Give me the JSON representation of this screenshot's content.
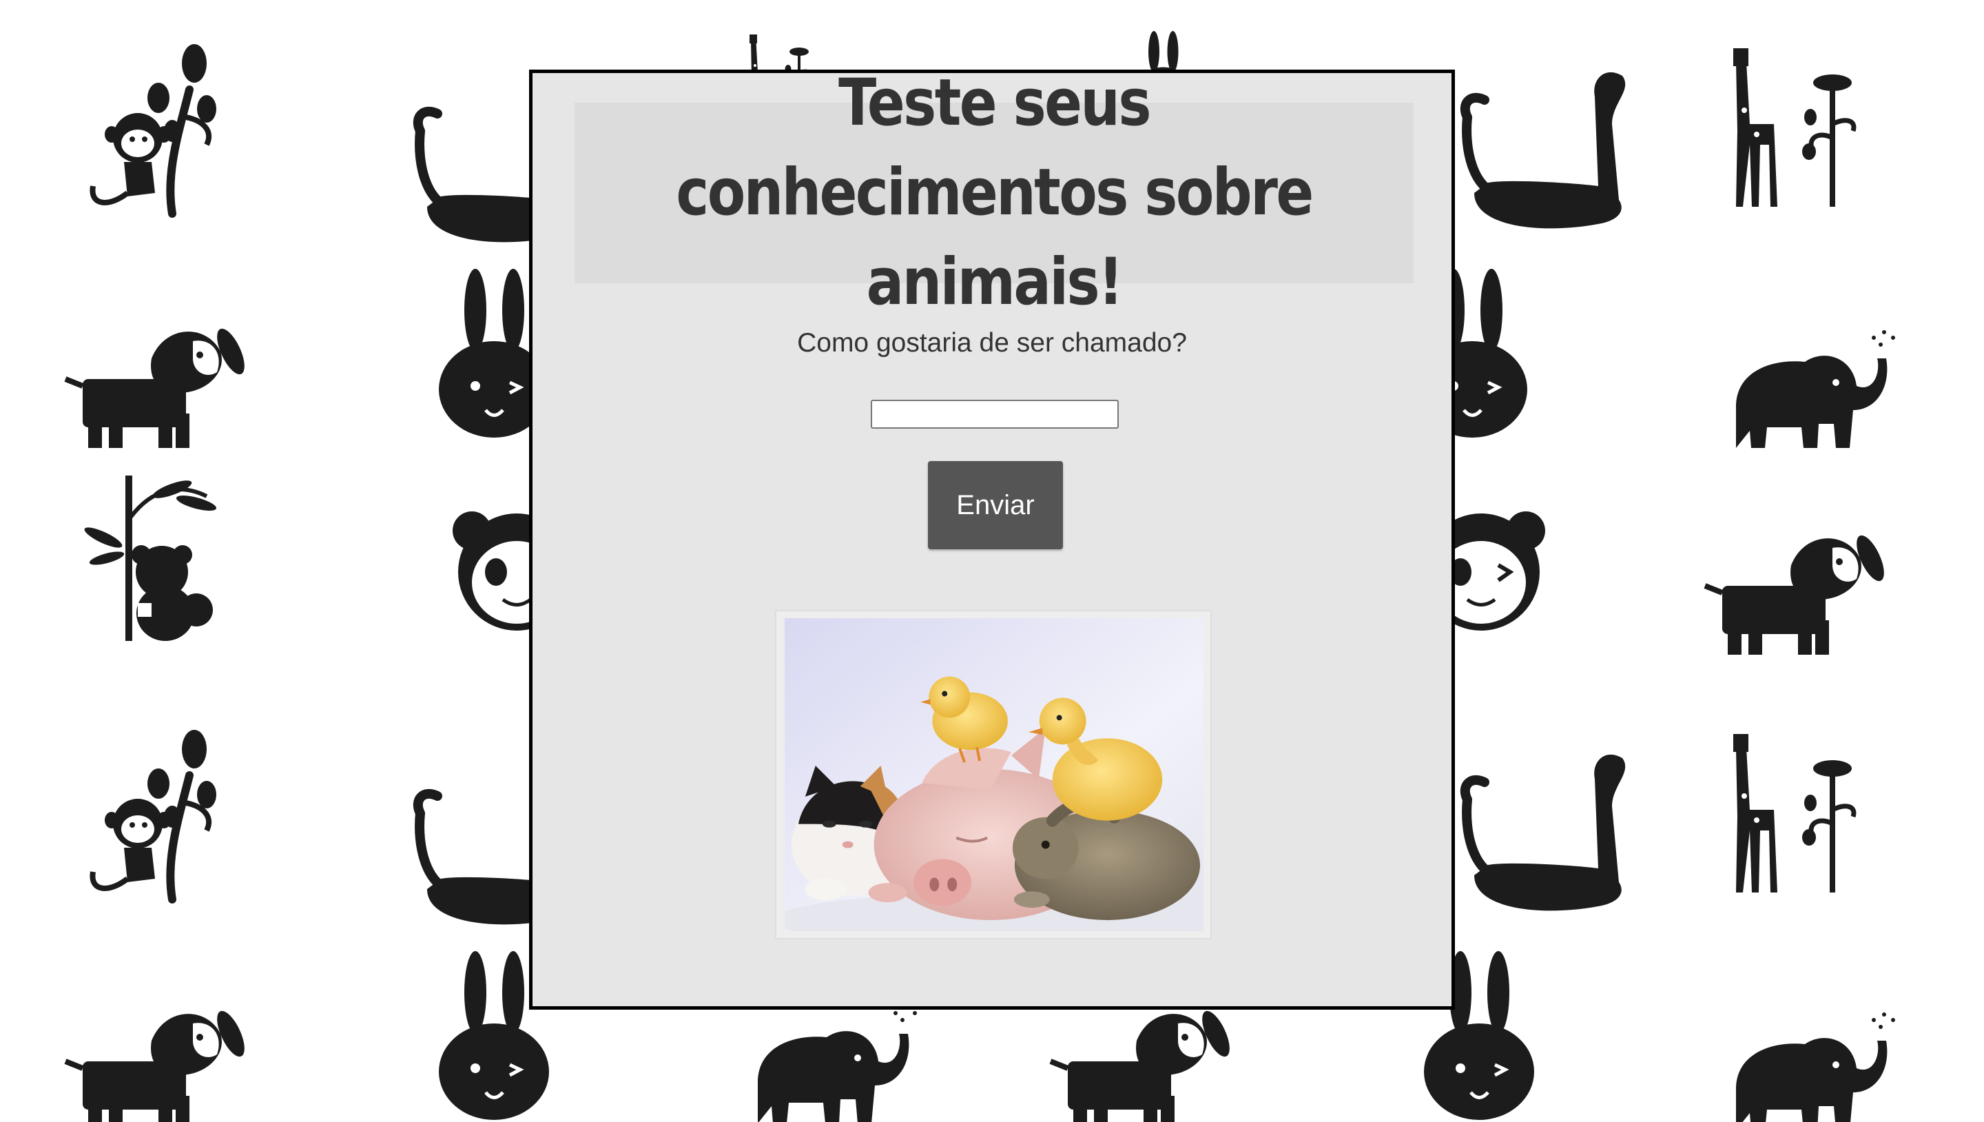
{
  "quiz": {
    "title": "Teste seus conhecimentos sobre animais!",
    "prompt": "Como gostaria de ser chamado?",
    "name_input_value": "",
    "submit_label": "Enviar"
  },
  "photo": {
    "icon": "baby-animals-photo"
  },
  "background": {
    "icons": [
      "monkey-icon",
      "dinosaur-icon",
      "giraffe-icon",
      "dog-icon",
      "rabbit-icon",
      "elephant-icon",
      "koala-icon",
      "panda-icon"
    ]
  },
  "colors": {
    "panel_bg": "#e6e6e6",
    "title_bg": "#dcdcdc",
    "text": "#333333",
    "button_bg": "#555555",
    "button_text": "#ffffff",
    "icon_fill": "#1c1c1c"
  }
}
